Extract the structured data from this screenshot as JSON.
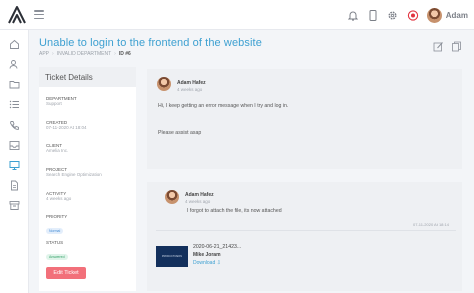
{
  "topbar": {
    "user_name": "Adam",
    "icons": [
      "logo-icon",
      "menu-icon",
      "bell-icon",
      "tablet-icon",
      "gear-icon",
      "record-icon"
    ]
  },
  "sidebar": {
    "items": [
      "home-icon",
      "users-icon",
      "folder-icon",
      "list-icon",
      "phone-icon",
      "inbox-icon",
      "monitor-icon",
      "document-icon",
      "archive-icon"
    ]
  },
  "header": {
    "title": "Unable to login to the frontend of the website",
    "breadcrumb": [
      "APP",
      "INVALID DEPARTMENT",
      "ID #6"
    ]
  },
  "details": {
    "title": "Ticket Details",
    "fields": [
      {
        "label": "DEPARTMENT",
        "value": "Support"
      },
      {
        "label": "CREATED",
        "value": "07-11-2020 At 18:04"
      },
      {
        "label": "CLIENT",
        "value": "Amelia Inc."
      },
      {
        "label": "PROJECT",
        "value": "Search Engine Optimization"
      },
      {
        "label": "ACTIVITY",
        "value": "4 weeks ago"
      },
      {
        "label": "PRIORITY",
        "value": "Normal"
      },
      {
        "label": "STATUS",
        "value": "Answered"
      }
    ],
    "edit_label": "Edit Ticket"
  },
  "messages": [
    {
      "author": "Adam Hafez",
      "time": "4 weeks ago",
      "lines": [
        "Hi, I keep getting an error message when I try and log in.",
        "Please assist asap"
      ]
    },
    {
      "author": "Adam Hafez",
      "time": "4 weeks ago",
      "lines": [
        "I forgot to attach the file, its now attached"
      ],
      "date": "07-11-2020 At 18:14",
      "attachment": {
        "name": "2020-06-21_21423...",
        "user": "Mike Joram",
        "download": "Download ⇩",
        "thumb_text": "PRODUCTIVEON"
      }
    }
  ],
  "colors": {
    "accent": "#3da0d1",
    "danger": "#f2707a",
    "panel": "#eef0f3"
  }
}
